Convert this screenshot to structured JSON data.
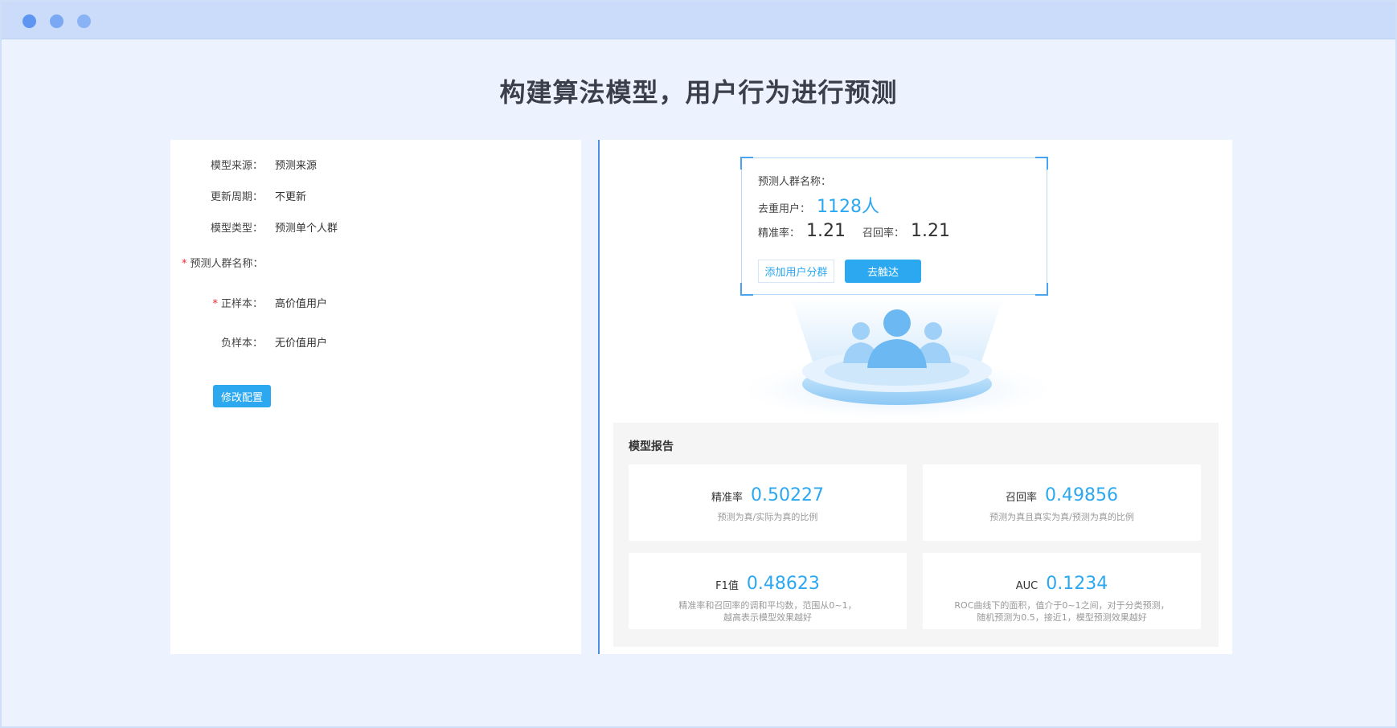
{
  "headline": "构建算法模型，用户行为进行预测",
  "config": {
    "fields": [
      {
        "label": "模型来源：",
        "value": "预测来源"
      },
      {
        "label": "更新周期：",
        "value": "不更新"
      },
      {
        "label": "模型类型：",
        "value": "预测单个人群"
      }
    ],
    "group_name_label": "预测人群名称：",
    "positive_label": "正样本：",
    "positive_value": "高价值用户",
    "negative_label": "负样本：",
    "negative_value": "无价值用户",
    "required_mark": "*",
    "edit_button": "修改配置"
  },
  "prediction": {
    "group_name_label": "预测人群名称：",
    "dedup_label": "去重用户：",
    "dedup_value": "1128人",
    "precision_label": "精准率：",
    "precision_value": "1.21",
    "recall_label": "召回率：",
    "recall_value": "1.21",
    "add_segment_button": "添加用户分群",
    "reach_button": "去触达"
  },
  "report": {
    "title": "模型报告",
    "metrics": [
      {
        "label": "精准率",
        "value": "0.50227",
        "desc": "预测为真/实际为真的比例"
      },
      {
        "label": "召回率",
        "value": "0.49856",
        "desc": "预测为真且真实为真/预测为真的比例"
      },
      {
        "label": "F1值",
        "value": "0.48623",
        "desc": "精准率和召回率的调和平均数，范围从0~1，\n越高表示模型效果越好"
      },
      {
        "label": "AUC",
        "value": "0.1234",
        "desc": "ROC曲线下的面积，值介于0~1之间，对于分类预测，\n随机预测为0.5，接近1，模型预测效果越好"
      }
    ]
  },
  "colors": {
    "accent": "#2ba8f0",
    "titlebar": "#cadcf9",
    "background": "#edf3fe"
  },
  "icons": [
    "users-group-icon"
  ]
}
